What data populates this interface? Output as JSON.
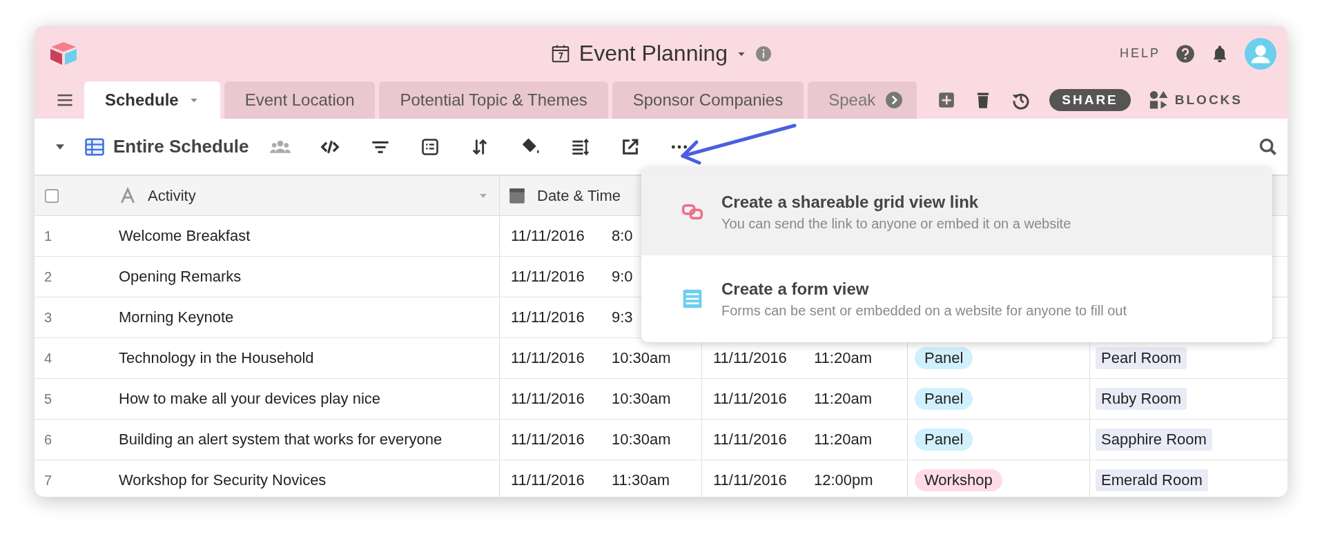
{
  "app": {
    "title": "Event Planning",
    "help": "HELP"
  },
  "tabs": [
    {
      "label": "Schedule",
      "selected": true
    },
    {
      "label": "Event Location",
      "selected": false
    },
    {
      "label": "Potential Topic & Themes",
      "selected": false
    },
    {
      "label": "Sponsor Companies",
      "selected": false
    },
    {
      "label": "Speak",
      "selected": false
    }
  ],
  "actions": {
    "share": "SHARE",
    "blocks": "BLOCKS"
  },
  "view": {
    "name": "Entire Schedule"
  },
  "table": {
    "select_all": {
      "checked": false
    },
    "columns": [
      "Activity",
      "Date & Time"
    ],
    "rows": [
      {
        "number": "1",
        "activity": "Welcome Breakfast",
        "start_date": "11/11/2016",
        "start_time": "8:0"
      },
      {
        "number": "2",
        "activity": "Opening Remarks",
        "start_date": "11/11/2016",
        "start_time": "9:0"
      },
      {
        "number": "3",
        "activity": "Morning Keynote",
        "start_date": "11/11/2016",
        "start_time": "9:3"
      },
      {
        "number": "4",
        "activity": "Technology in the Household",
        "start_date": "11/11/2016",
        "start_time": "10:30am",
        "end_date": "11/11/2016",
        "end_time": "11:20am",
        "type": {
          "label": "Panel",
          "color": "#d0f0fd"
        },
        "room": "Pearl Room"
      },
      {
        "number": "5",
        "activity": "How to make all your devices play nice",
        "start_date": "11/11/2016",
        "start_time": "10:30am",
        "end_date": "11/11/2016",
        "end_time": "11:20am",
        "type": {
          "label": "Panel",
          "color": "#d0f0fd"
        },
        "room": "Ruby Room"
      },
      {
        "number": "6",
        "activity": "Building an alert system that works for everyone",
        "start_date": "11/11/2016",
        "start_time": "10:30am",
        "end_date": "11/11/2016",
        "end_time": "11:20am",
        "type": {
          "label": "Panel",
          "color": "#d0f0fd"
        },
        "room": "Sapphire Room"
      },
      {
        "number": "7",
        "activity": "Workshop for Security Novices",
        "start_date": "11/11/2016",
        "start_time": "11:30am",
        "end_date": "11/11/2016",
        "end_time": "12:00pm",
        "type": {
          "label": "Workshop",
          "color": "#ffdce5"
        },
        "room": "Emerald Room"
      }
    ]
  },
  "menu": {
    "items": [
      {
        "kind": "link",
        "title": "Create a shareable grid view link",
        "description": "You can send the link to anyone or embed it on a website",
        "selected": true
      },
      {
        "kind": "form",
        "title": "Create a form view",
        "description": "Forms can be sent or embedded on a website for anyone to fill out",
        "selected": false
      }
    ]
  }
}
